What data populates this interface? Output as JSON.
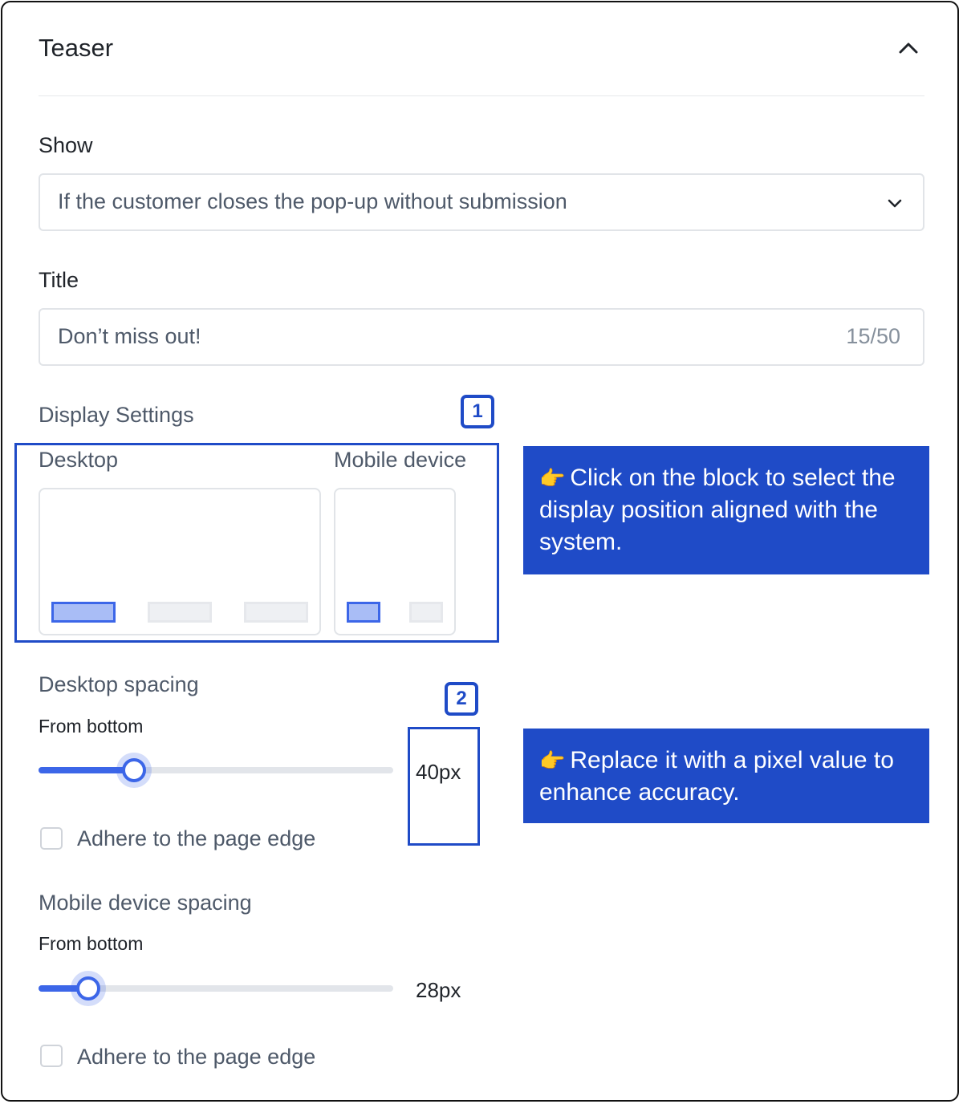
{
  "panel": {
    "title": "Teaser"
  },
  "show": {
    "label": "Show",
    "selected": "If the customer closes the pop-up without submission"
  },
  "title_field": {
    "label": "Title",
    "value": "Don’t miss out!",
    "counter": "15/50"
  },
  "display_settings": {
    "label": "Display Settings",
    "badge": "1",
    "desktop_label": "Desktop",
    "mobile_label": "Mobile device",
    "desktop_selected_slot": 0,
    "mobile_selected_slot": 0
  },
  "callouts": {
    "one": "Click on the block to select the display position aligned with the system.",
    "two": "Replace it with a pixel value to enhance accuracy.",
    "hand_icon": "pointing-hand-icon"
  },
  "desktop_spacing": {
    "label": "Desktop spacing",
    "badge": "2",
    "sublabel": "From bottom",
    "value_text": "40px",
    "slider_fraction": 0.27,
    "checkbox_label": "Adhere to the page edge",
    "checked": false
  },
  "mobile_spacing": {
    "label": "Mobile device spacing",
    "sublabel": "From bottom",
    "value_text": "28px",
    "slider_fraction": 0.14,
    "checkbox_label": "Adhere to the page edge",
    "checked": false
  },
  "colors": {
    "accent": "#3c66e8",
    "callout_bg": "#1f4bc7",
    "slot_active": "#a9bdf6",
    "slot_idle": "#eef0f3"
  }
}
